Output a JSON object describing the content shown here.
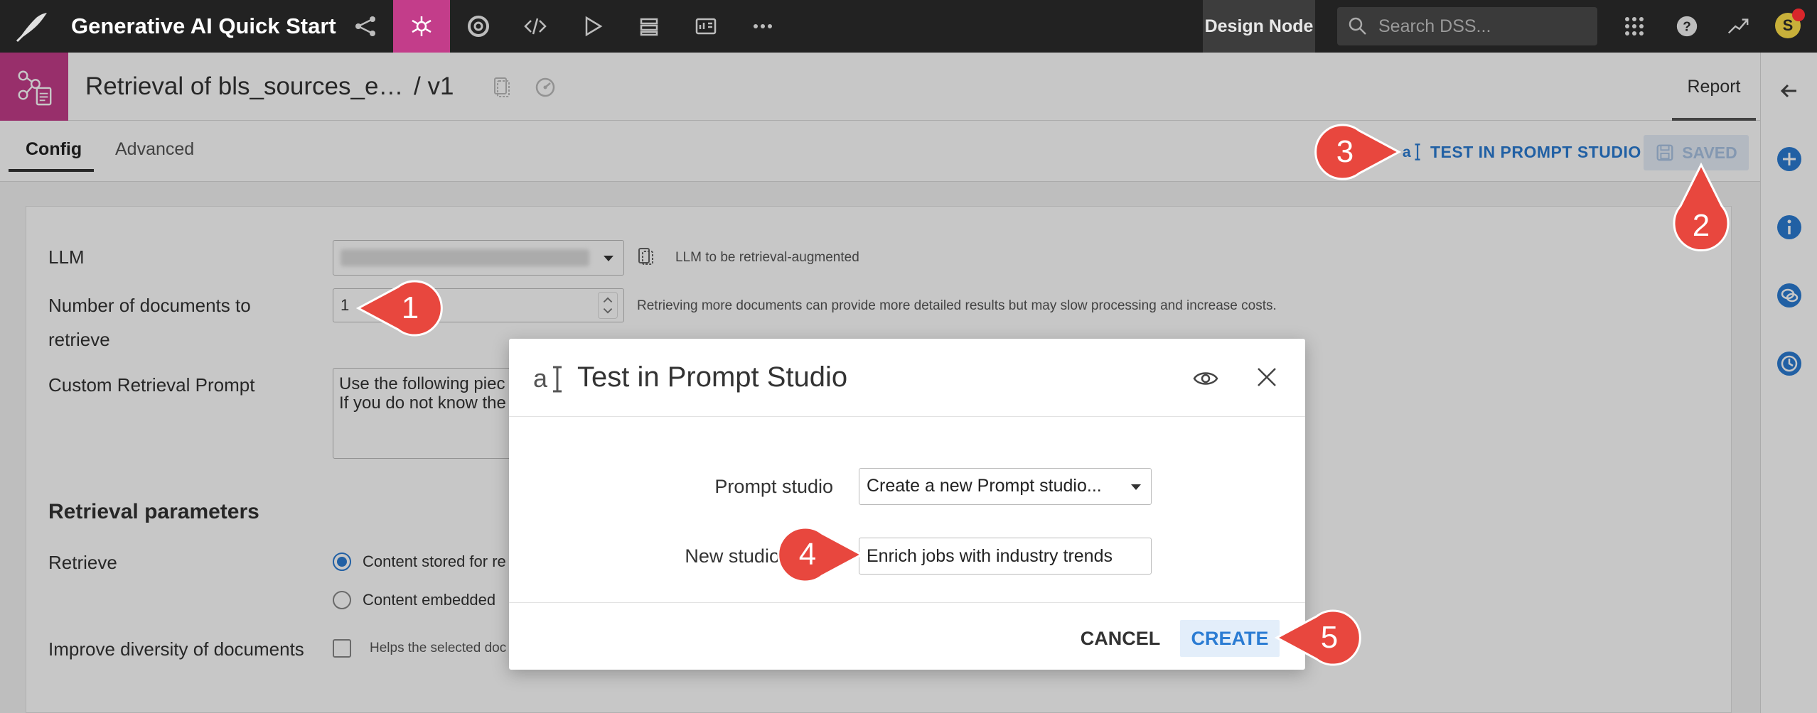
{
  "topnav": {
    "project_title": "Generative AI Quick Start",
    "design_node": "Design Node",
    "search_placeholder": "Search DSS...",
    "avatar_initial": "S"
  },
  "recipe": {
    "title": "Retrieval of bls_sources_e…",
    "version": "/ v1",
    "report_tab": "Report"
  },
  "tabs": {
    "config": "Config",
    "advanced": "Advanced",
    "test_button": "TEST IN PROMPT STUDIO",
    "saved_button": "SAVED"
  },
  "form": {
    "llm_label": "LLM",
    "llm_help": "LLM to be retrieval-augmented",
    "num_docs_label_line1": "Number of documents to",
    "num_docs_label_line2": "retrieve",
    "num_docs_value": "1",
    "num_docs_help": "Retrieving more documents can provide more detailed results but may slow processing and increase costs.",
    "custom_prompt_label": "Custom Retrieval Prompt",
    "custom_prompt_line1": "Use the following piec",
    "custom_prompt_line2": "If you do not know the",
    "retrieval_params_title": "Retrieval parameters",
    "retrieve_label": "Retrieve",
    "retrieve_option1": "Content stored for re",
    "retrieve_option2": "Content embedded",
    "diversity_label": "Improve diversity of documents",
    "diversity_help": "Helps the selected doc"
  },
  "modal": {
    "title": "Test in Prompt Studio",
    "prompt_studio_label": "Prompt studio",
    "prompt_studio_value": "Create a new Prompt studio...",
    "new_name_label": "New studio name",
    "new_name_value": "Enrich jobs with industry trends",
    "cancel": "CANCEL",
    "create": "CREATE"
  },
  "callouts": [
    "1",
    "2",
    "3",
    "4",
    "5"
  ],
  "colors": {
    "accent_pink": "#c33d8a",
    "link_blue": "#2b7cd3",
    "callout_red": "#e8473e",
    "topnav_bg": "#222222"
  }
}
